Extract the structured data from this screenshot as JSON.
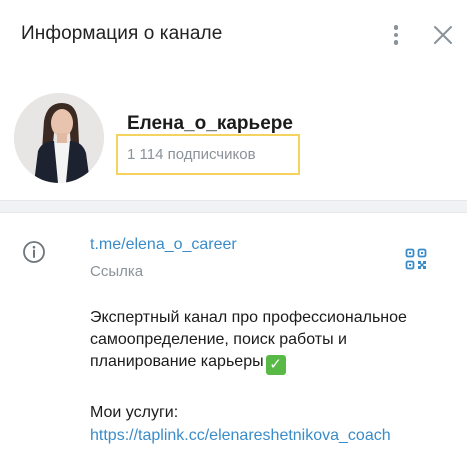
{
  "header": {
    "title": "Информация о канале",
    "more_icon": "more-vertical-icon",
    "close_icon": "close-icon"
  },
  "profile": {
    "name": "Елена_о_карьере",
    "subscribers": "1 114 подписчиков"
  },
  "info": {
    "icon": "info-icon",
    "link": "t.me/elena_o_career",
    "link_caption": "Ссылка",
    "qr_icon": "qr-code-icon",
    "description_lines": [
      "Экспертный канал про профессиональное",
      "самоопределение, поиск работы и",
      "планирование карьеры"
    ],
    "description_emoji": "✓",
    "services_label": "Мои услуги:",
    "services_link": "https://taplink.cc/elenareshetnikova_coach"
  },
  "colors": {
    "link": "#3a8cc8",
    "secondary_text": "#8a9399",
    "highlight_box": "#f4d35e",
    "divider": "#f1f2f4"
  }
}
